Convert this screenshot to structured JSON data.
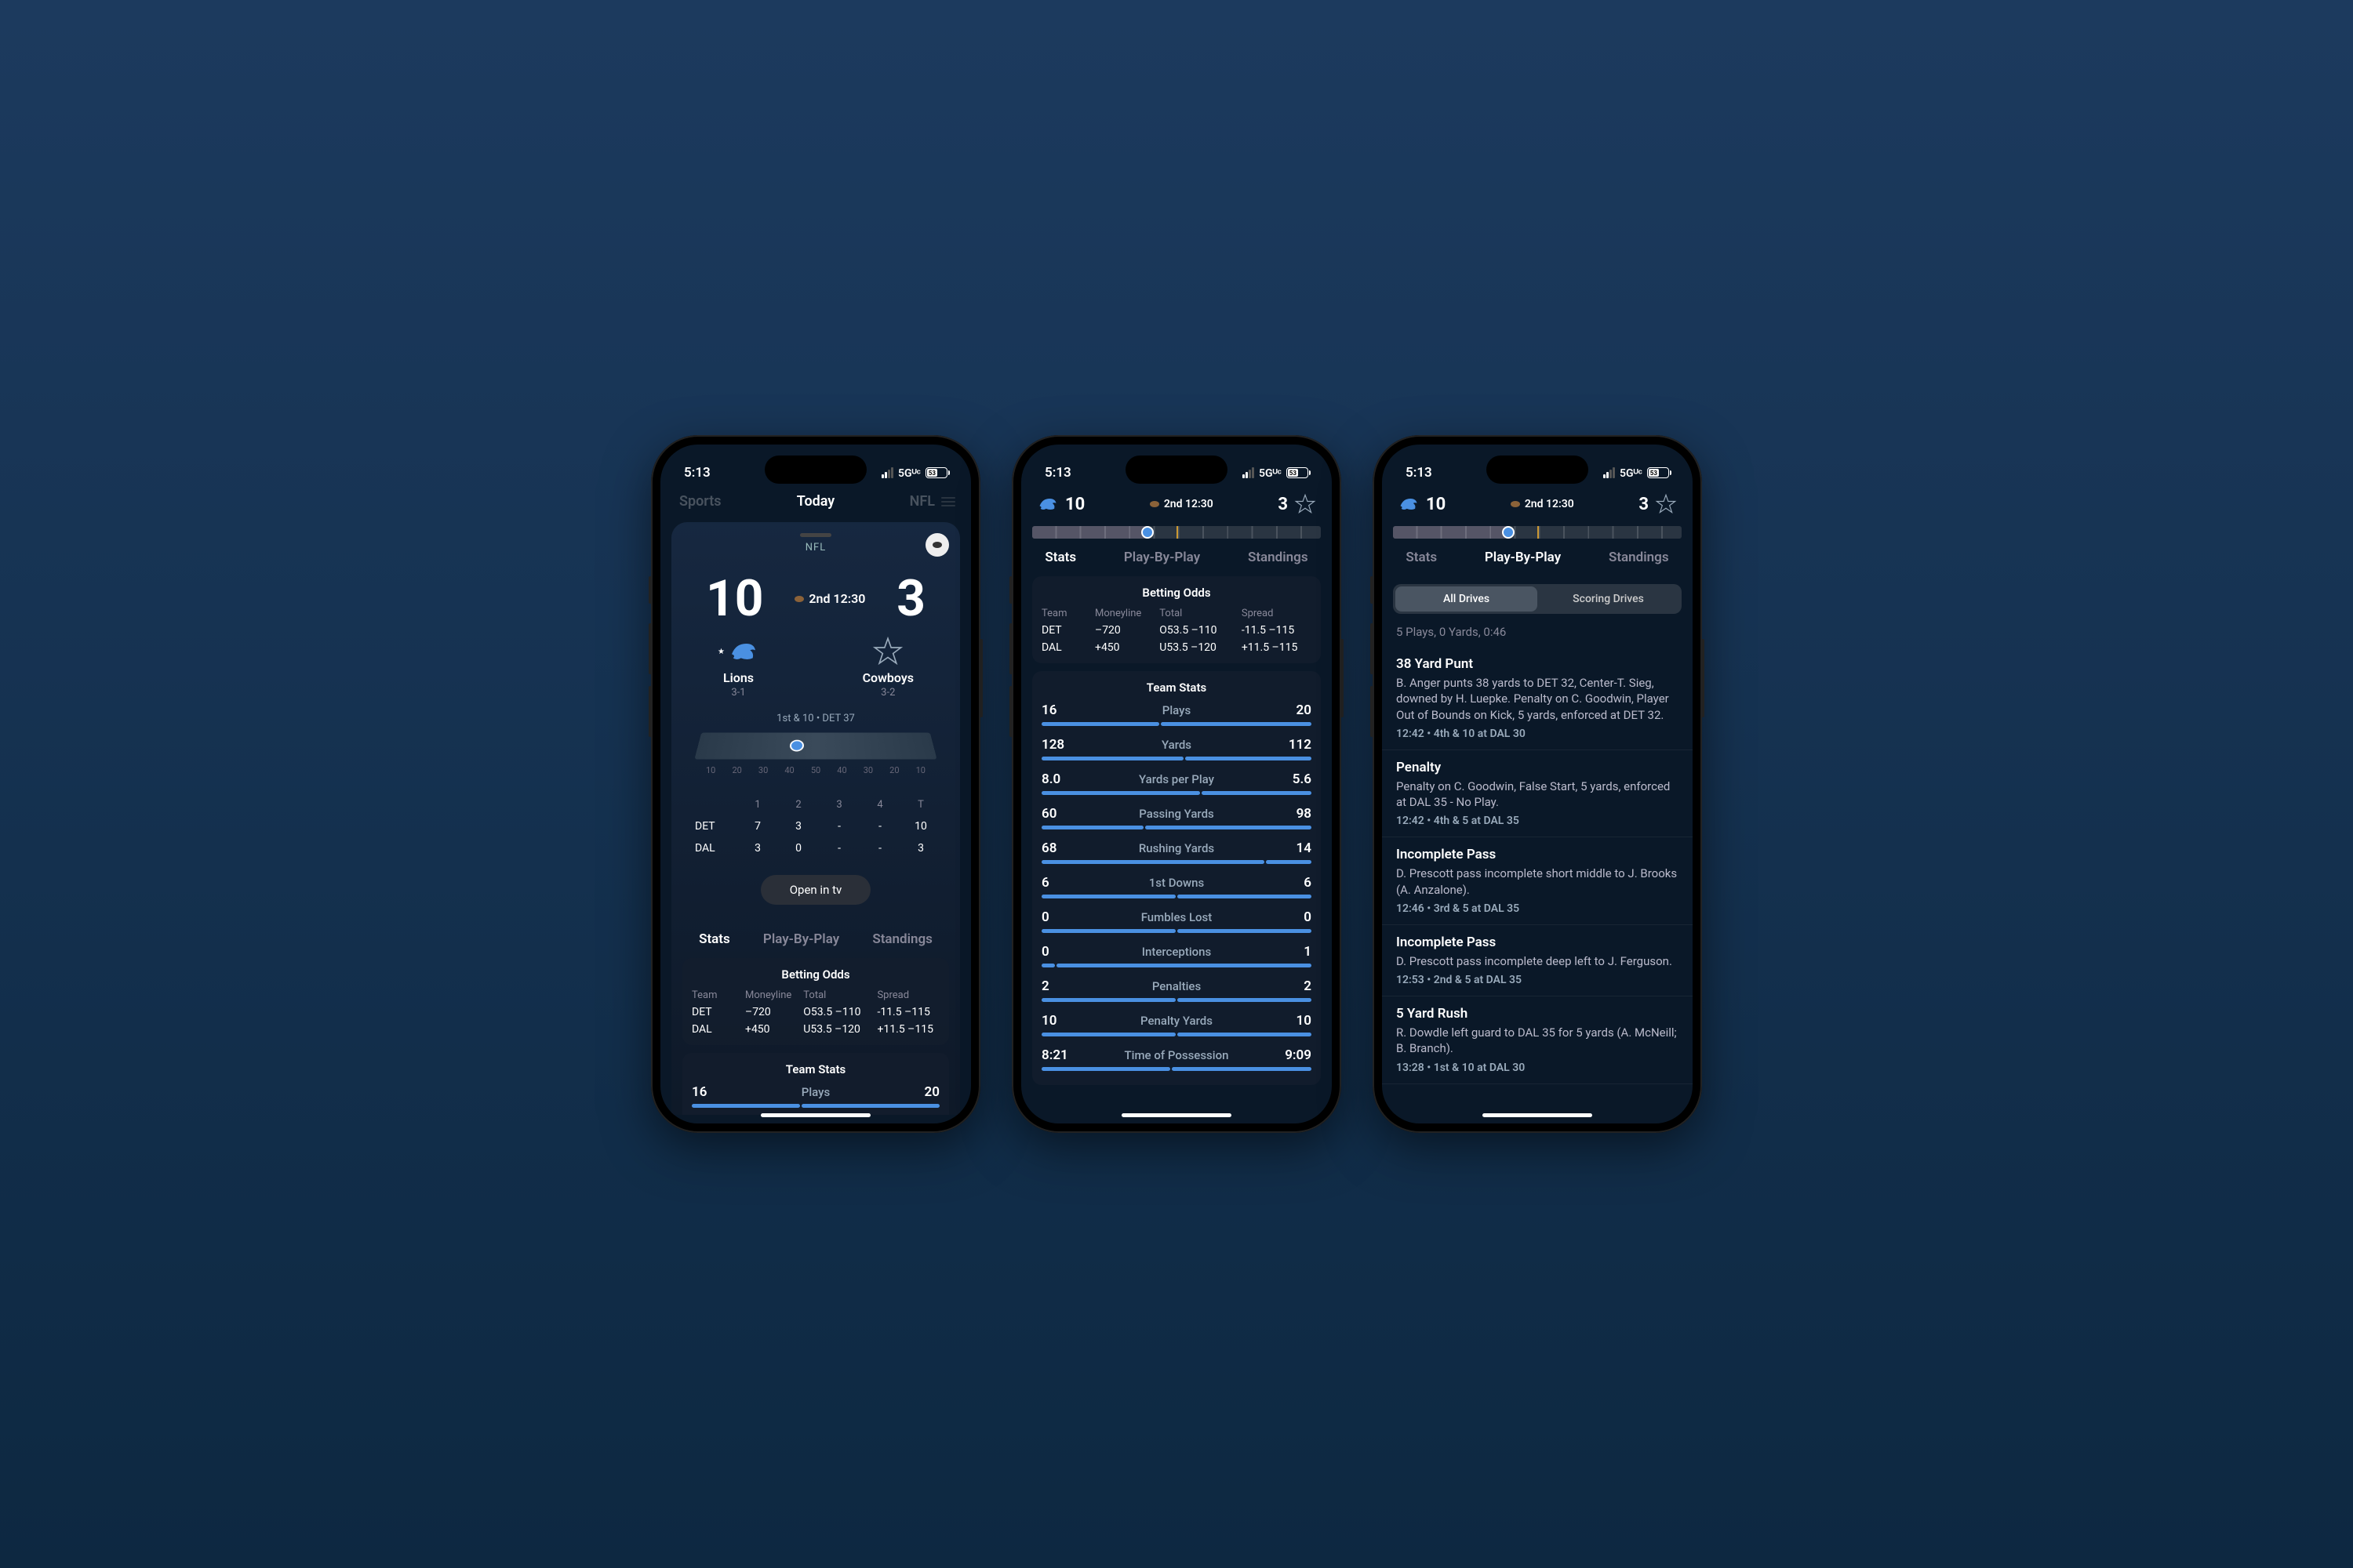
{
  "status": {
    "time": "5:13",
    "network": "5Gᵁᶜ",
    "battery": "53"
  },
  "header": {
    "title": "Today",
    "brand": "Sports",
    "league_pill": "NFL"
  },
  "game": {
    "league": "NFL",
    "away": {
      "abbr": "DAL",
      "name": "Cowboys",
      "record": "3-2",
      "score": "3"
    },
    "home": {
      "abbr": "DET",
      "name": "Lions",
      "record": "3-1",
      "score": "10"
    },
    "clock": "2nd 12:30",
    "down_distance": "1st & 10 • DET 37",
    "yard_labels": [
      "10",
      "20",
      "30",
      "40",
      "50",
      "40",
      "30",
      "20",
      "10"
    ]
  },
  "line_score": {
    "headers": [
      "1",
      "2",
      "3",
      "4",
      "T"
    ],
    "rows": [
      {
        "team": "DET",
        "q": [
          "7",
          "3",
          "-",
          "-"
        ],
        "total": "10"
      },
      {
        "team": "DAL",
        "q": [
          "3",
          "0",
          "-",
          "-"
        ],
        "total": "3"
      }
    ]
  },
  "open_tv": "Open in tv",
  "tabs": {
    "stats": "Stats",
    "pbp": "Play-By-Play",
    "standings": "Standings"
  },
  "odds": {
    "title": "Betting Odds",
    "headers": [
      "Team",
      "Moneyline",
      "Total",
      "Spread"
    ],
    "rows": [
      {
        "team": "DET",
        "ml": "–720",
        "total": "O53.5  –110",
        "spread": "-11.5  –115"
      },
      {
        "team": "DAL",
        "ml": "+450",
        "total": "U53.5  –120",
        "spread": "+11.5  –115"
      }
    ]
  },
  "team_stats": {
    "title": "Team Stats",
    "rows": [
      {
        "label": "Plays",
        "l": "16",
        "r": "20",
        "lp": 44,
        "rp": 56
      },
      {
        "label": "Yards",
        "l": "128",
        "r": "112",
        "lp": 53,
        "rp": 47
      },
      {
        "label": "Yards per Play",
        "l": "8.0",
        "r": "5.6",
        "lp": 59,
        "rp": 41
      },
      {
        "label": "Passing Yards",
        "l": "60",
        "r": "98",
        "lp": 38,
        "rp": 62
      },
      {
        "label": "Rushing Yards",
        "l": "68",
        "r": "14",
        "lp": 83,
        "rp": 17
      },
      {
        "label": "1st Downs",
        "l": "6",
        "r": "6",
        "lp": 50,
        "rp": 50
      },
      {
        "label": "Fumbles Lost",
        "l": "0",
        "r": "0",
        "lp": 50,
        "rp": 50
      },
      {
        "label": "Interceptions",
        "l": "0",
        "r": "1",
        "lp": 5,
        "rp": 95
      },
      {
        "label": "Penalties",
        "l": "2",
        "r": "2",
        "lp": 50,
        "rp": 50
      },
      {
        "label": "Penalty Yards",
        "l": "10",
        "r": "10",
        "lp": 50,
        "rp": 50
      },
      {
        "label": "Time of Possession",
        "l": "8:21",
        "r": "9:09",
        "lp": 48,
        "rp": 52
      }
    ]
  },
  "drives_segment": {
    "all": "All Drives",
    "scoring": "Scoring Drives"
  },
  "current_drive": "5 Plays, 0 Yards, 0:46",
  "plays": [
    {
      "title": "38 Yard Punt",
      "desc": "B. Anger punts 38 yards to DET 32, Center-T. Sieg, downed by H. Luepke. Penalty on C. Goodwin, Player Out of Bounds on Kick, 5 yards, enforced at DET 32.",
      "meta": "12:42 • 4th & 10 at DAL 30"
    },
    {
      "title": "Penalty",
      "desc": "Penalty on C. Goodwin, False Start, 5 yards, enforced at DAL 35 - No Play.",
      "meta": "12:42 • 4th & 5 at DAL 35"
    },
    {
      "title": "Incomplete Pass",
      "desc": "D. Prescott pass incomplete short middle to J. Brooks (A. Anzalone).",
      "meta": "12:46 • 3rd & 5 at DAL 35"
    },
    {
      "title": "Incomplete Pass",
      "desc": "D. Prescott pass incomplete deep left to J. Ferguson.",
      "meta": "12:53 • 2nd & 5 at DAL 35"
    },
    {
      "title": "5 Yard Rush",
      "desc": "R. Dowdle left guard to DAL 35 for 5 yards (A. McNeill; B. Branch).",
      "meta": "13:28 • 1st & 10 at DAL 30"
    }
  ]
}
